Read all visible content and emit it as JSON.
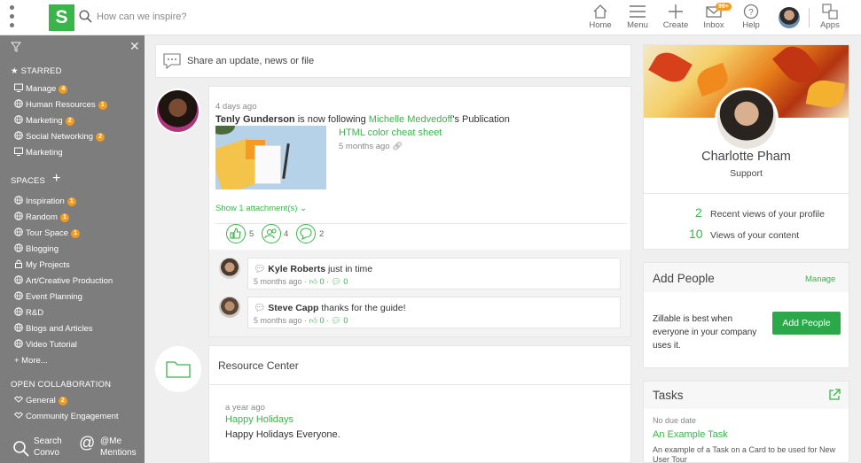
{
  "app": {
    "logo_letter": "S",
    "brand_color": "#3ab54a"
  },
  "search": {
    "placeholder": "How can we inspire?"
  },
  "nav": {
    "home": "Home",
    "menu": "Menu",
    "create": "Create",
    "inbox": "Inbox",
    "inbox_badge": "99+",
    "help": "Help",
    "apps": "Apps"
  },
  "sidebar": {
    "starred_heading": "STARRED",
    "starred": [
      {
        "label": "Manage",
        "badge": "4",
        "icon": "board-icon"
      },
      {
        "label": "Human Resources",
        "badge": "1",
        "icon": "globe-icon"
      },
      {
        "label": "Marketing",
        "badge": "2",
        "icon": "globe-icon"
      },
      {
        "label": "Social Networking",
        "badge": "2",
        "icon": "globe-icon"
      },
      {
        "label": "Marketing",
        "badge": "",
        "icon": "board-icon"
      }
    ],
    "spaces_heading": "SPACES",
    "spaces": [
      {
        "label": "Inspiration",
        "badge": "1",
        "icon": "globe-icon"
      },
      {
        "label": "Random",
        "badge": "1",
        "icon": "globe-icon"
      },
      {
        "label": "Tour Space",
        "badge": "1",
        "icon": "globe-icon"
      },
      {
        "label": "Blogging",
        "badge": "",
        "icon": "globe-icon"
      },
      {
        "label": "My Projects",
        "badge": "",
        "icon": "lock-icon"
      },
      {
        "label": "Art/Creative Production",
        "badge": "",
        "icon": "globe-icon"
      },
      {
        "label": "Event Planning",
        "badge": "",
        "icon": "globe-icon"
      },
      {
        "label": "R&D",
        "badge": "",
        "icon": "globe-icon"
      },
      {
        "label": "Blogs and Articles",
        "badge": "",
        "icon": "globe-icon"
      },
      {
        "label": "Video Tutorial",
        "badge": "",
        "icon": "globe-icon"
      }
    ],
    "more": "+ More...",
    "open_heading": "OPEN COLLABORATION",
    "open": [
      {
        "label": "General",
        "badge": "2",
        "icon": "handshake-icon"
      },
      {
        "label": "Community Engagement",
        "badge": "",
        "icon": "handshake-icon"
      }
    ],
    "bottom_left": {
      "line1": "Search",
      "line2": "Convo"
    },
    "bottom_right": {
      "line1": "@Me",
      "line2": "Mentions"
    }
  },
  "share": {
    "placeholder": "Share an update, news or file"
  },
  "post": {
    "time": "4 days ago",
    "actor": "Tenly Gunderson",
    "action": " is now following ",
    "target": "Michelle Medvedoff",
    "suffix": "'s Publication",
    "link_title": "HTML color cheat sheet",
    "link_time": "5 months ago",
    "attachments": "Show 1 attachment(s) ⌄",
    "likes": "5",
    "people": "4",
    "comments": "2",
    "comment_list": [
      {
        "author": "Kyle Roberts",
        "text": " just in time",
        "time": "5 months ago",
        "likes": "0",
        "replies": "0"
      },
      {
        "author": "Steve Capp",
        "text": " thanks for the guide!",
        "time": "5 months ago",
        "likes": "0",
        "replies": "0"
      }
    ]
  },
  "resource": {
    "title": "Resource Center",
    "time": "a year ago",
    "item_title": "Happy Holidays",
    "item_text": "Happy Holidays Everyone."
  },
  "profile": {
    "name": "Charlotte Pham",
    "role": "Support",
    "views_count": "2",
    "views_label": "Recent views of your profile",
    "content_count": "10",
    "content_label": "Views of your content"
  },
  "add_people": {
    "title": "Add People",
    "manage": "Manage",
    "text": "Zillable is best when everyone in your company uses it.",
    "button": "Add People"
  },
  "tasks": {
    "title": "Tasks",
    "due": "No due date",
    "task_title": "An Example Task",
    "task_text": "An example of a Task on a Card to be used for New User Tour"
  }
}
